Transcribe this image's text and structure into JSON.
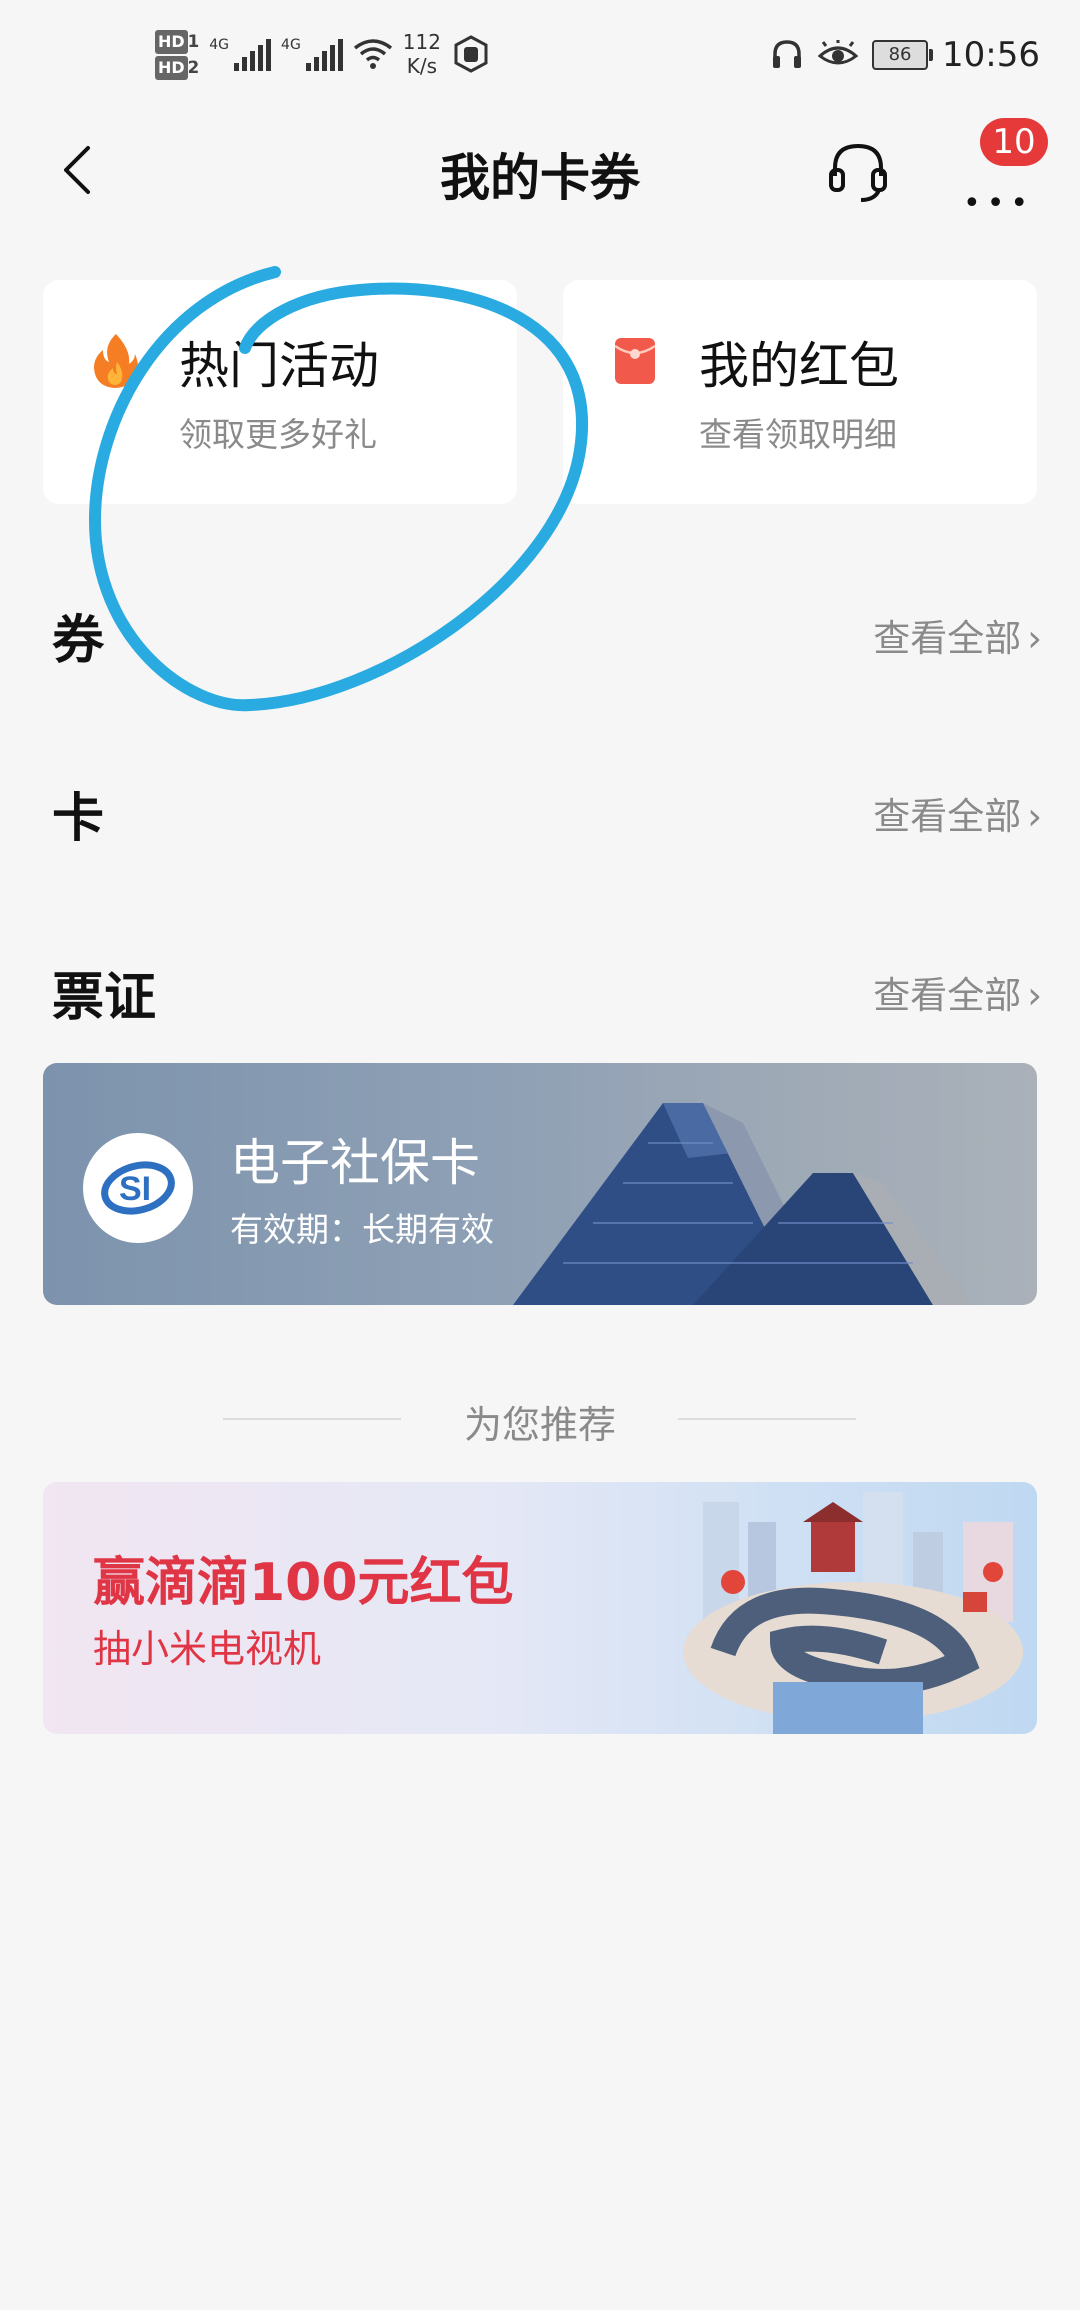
{
  "status_bar": {
    "hd1": "HD",
    "hd1_sub": "1",
    "hd2": "HD",
    "hd2_sub": "2",
    "net1": "4G",
    "net2": "4G",
    "speed_value": "112",
    "speed_unit": "K/s",
    "battery": "86",
    "time": "10:56"
  },
  "header": {
    "title": "我的卡券",
    "badge": "10"
  },
  "cards": [
    {
      "title": "热门活动",
      "subtitle": "领取更多好礼",
      "icon": "flame-icon"
    },
    {
      "title": "我的红包",
      "subtitle": "查看领取明细",
      "icon": "red-envelope-icon"
    }
  ],
  "sections": [
    {
      "title": "券",
      "view_all": "查看全部"
    },
    {
      "title": "卡",
      "view_all": "查看全部"
    },
    {
      "title": "票证",
      "view_all": "查看全部"
    }
  ],
  "social_card": {
    "title": "电子社保卡",
    "validity": "有效期：长期有效"
  },
  "recommend_label": "为您推荐",
  "promo": {
    "title": "赢滴滴100元红包",
    "subtitle": "抽小米电视机"
  },
  "colors": {
    "accent_red": "#e63a3a",
    "promo_red": "#e03545",
    "annotation_blue": "#29abe2",
    "background": "#f6f6f6"
  }
}
